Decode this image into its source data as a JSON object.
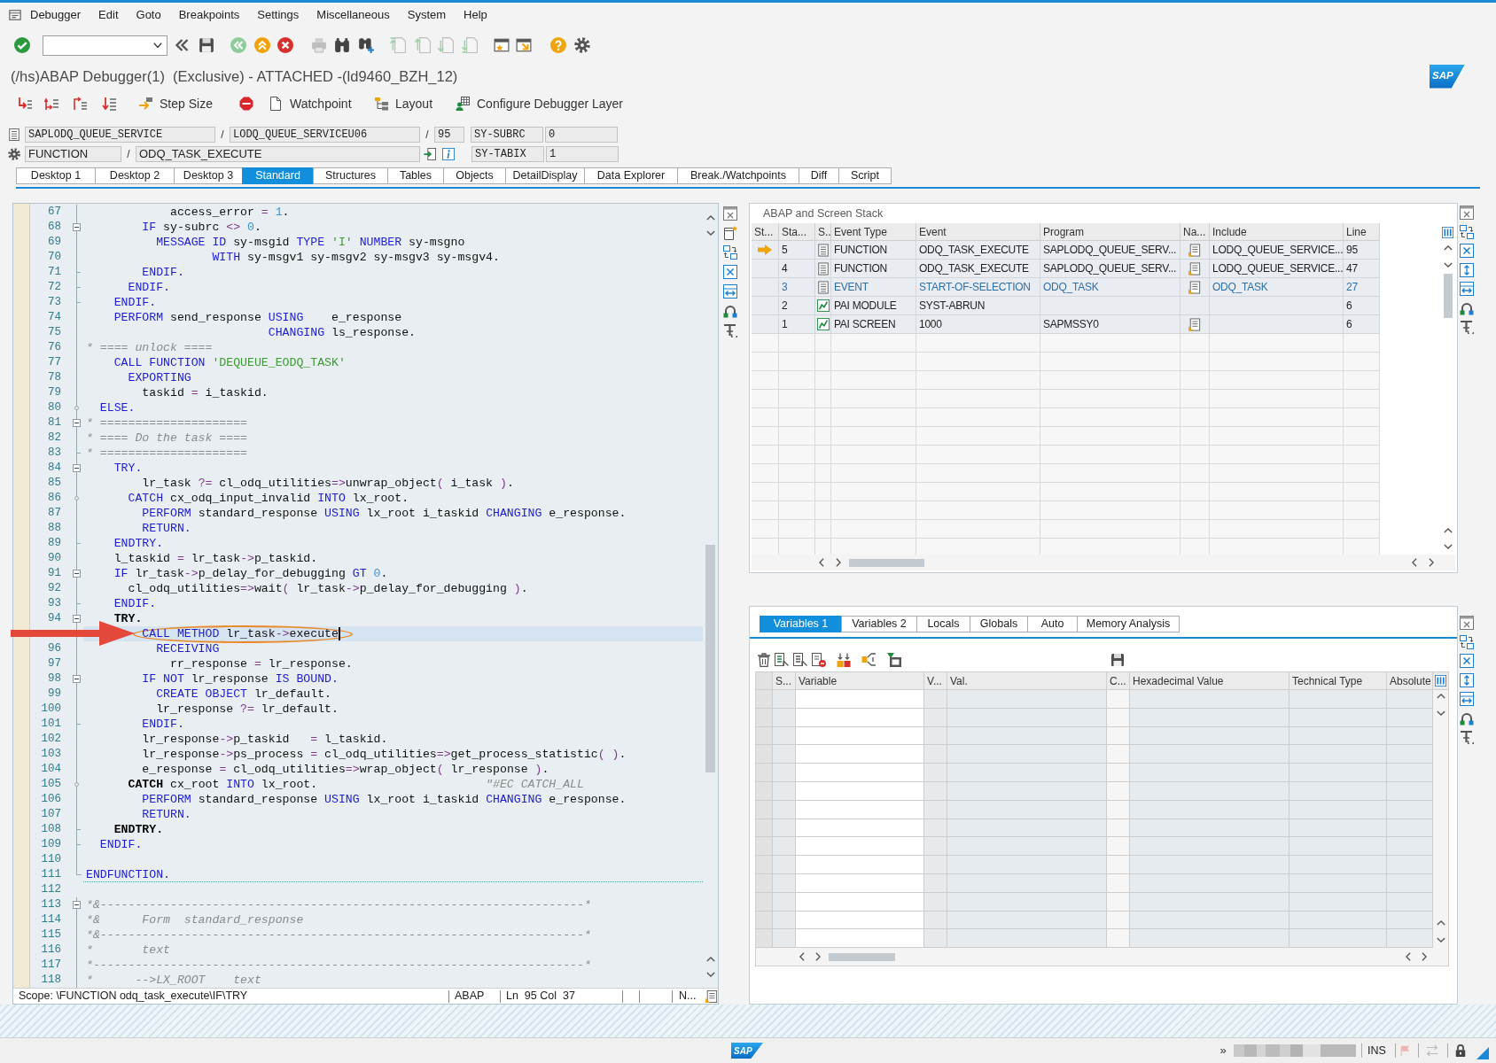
{
  "menu_bar": {
    "items": [
      "Debugger",
      "Edit",
      "Goto",
      "Breakpoints",
      "Settings",
      "Miscellaneous",
      "System",
      "Help"
    ]
  },
  "window": {
    "title": "(/hs)ABAP Debugger(1)  (Exclusive) - ATTACHED -(ld9460_BZH_12)",
    "logo": "SAP"
  },
  "app_toolbar": {
    "buttons": [
      "Step Size",
      "Watchpoint",
      "Layout",
      "Configure Debugger Layer"
    ]
  },
  "program_line": {
    "program": "SAPLODQ_QUEUE_SERVICE",
    "separator_1": "/",
    "include": "LODQ_QUEUE_SERVICEU06",
    "separator_2": "/",
    "line": "95",
    "variable": "SY-SUBRC",
    "value": "0"
  },
  "event_line": {
    "event_type": "FUNCTION",
    "separator": "/",
    "event": "ODQ_TASK_EXECUTE",
    "variable": "SY-TABIX",
    "value": "1"
  },
  "desktop_tabs": [
    {
      "label": "Desktop 1",
      "selected": false
    },
    {
      "label": "Desktop 2",
      "selected": false
    },
    {
      "label": "Desktop 3",
      "selected": false
    },
    {
      "label": "Standard",
      "selected": true
    },
    {
      "label": "Structures",
      "selected": false
    },
    {
      "label": "Tables",
      "selected": false
    },
    {
      "label": "Objects",
      "selected": false
    },
    {
      "label": "DetailDisplay",
      "selected": false
    },
    {
      "label": "Data Explorer",
      "selected": false
    },
    {
      "label": "Break./Watchpoints",
      "selected": false
    },
    {
      "label": "Diff",
      "selected": false
    },
    {
      "label": "Script",
      "selected": false
    }
  ],
  "editor": {
    "lines": [
      {
        "no": "67",
        "kind": "line",
        "current": false,
        "code": [
          {
            "kind": "tx",
            "text": "            access_error "
          },
          {
            "kind": "op",
            "text": "="
          },
          {
            "kind": "nu",
            "text": " 1"
          },
          {
            "kind": "tx",
            "text": "."
          }
        ]
      },
      {
        "no": "68",
        "kind": "open",
        "current": false,
        "code": [
          {
            "kind": "kw",
            "text": "        IF"
          },
          {
            "kind": "tx",
            "text": " sy-subrc "
          },
          {
            "kind": "op",
            "text": "<>"
          },
          {
            "kind": "nu",
            "text": " 0"
          },
          {
            "kind": "tx",
            "text": "."
          }
        ]
      },
      {
        "no": "69",
        "kind": "line",
        "current": false,
        "code": [
          {
            "kind": "kw",
            "text": "          MESSAGE ID"
          },
          {
            "kind": "tx",
            "text": " sy-msgid "
          },
          {
            "kind": "kw",
            "text": "TYPE"
          },
          {
            "kind": "st",
            "text": " 'I'"
          },
          {
            "kind": "kw",
            "text": " NUMBER"
          },
          {
            "kind": "tx",
            "text": " sy-msgno"
          }
        ]
      },
      {
        "no": "70",
        "kind": "line",
        "current": false,
        "code": [
          {
            "kind": "kw",
            "text": "                  WITH"
          },
          {
            "kind": "tx",
            "text": " sy-msgv1 sy-msgv2 sy-msgv3 sy-msgv4."
          }
        ]
      },
      {
        "no": "71",
        "kind": "end",
        "current": false,
        "code": [
          {
            "kind": "kw",
            "text": "        ENDIF."
          }
        ]
      },
      {
        "no": "72",
        "kind": "end",
        "current": false,
        "code": [
          {
            "kind": "kw",
            "text": "      ENDIF."
          }
        ]
      },
      {
        "no": "73",
        "kind": "end",
        "current": false,
        "code": [
          {
            "kind": "kw",
            "text": "    ENDIF."
          }
        ]
      },
      {
        "no": "74",
        "kind": "line",
        "current": false,
        "code": [
          {
            "kind": "kw",
            "text": "    PERFORM"
          },
          {
            "kind": "tx",
            "text": " send_response "
          },
          {
            "kind": "kw",
            "text": "USING"
          },
          {
            "kind": "tx",
            "text": "    e_response"
          }
        ]
      },
      {
        "no": "75",
        "kind": "line",
        "current": false,
        "code": [
          {
            "kind": "kw",
            "text": "                          CHANGING"
          },
          {
            "kind": "tx",
            "text": " ls_response."
          }
        ]
      },
      {
        "no": "76",
        "kind": "line",
        "current": false,
        "code": [
          {
            "kind": "cm",
            "text": "* ==== unlock ===="
          }
        ]
      },
      {
        "no": "77",
        "kind": "line",
        "current": false,
        "code": [
          {
            "kind": "kw",
            "text": "    CALL FUNCTION"
          },
          {
            "kind": "st",
            "text": " 'DEQUEUE_EODQ_TASK'"
          }
        ]
      },
      {
        "no": "78",
        "kind": "line",
        "current": false,
        "code": [
          {
            "kind": "kw",
            "text": "      EXPORTING"
          }
        ]
      },
      {
        "no": "79",
        "kind": "line",
        "current": false,
        "code": [
          {
            "kind": "tx",
            "text": "        taskid "
          },
          {
            "kind": "op",
            "text": "="
          },
          {
            "kind": "tx",
            "text": " i_taskid."
          }
        ]
      },
      {
        "no": "80",
        "kind": "branch",
        "current": false,
        "code": [
          {
            "kind": "kw",
            "text": "  ELSE."
          }
        ]
      },
      {
        "no": "81",
        "kind": "open",
        "current": false,
        "code": [
          {
            "kind": "cm",
            "text": "* ====================="
          }
        ]
      },
      {
        "no": "82",
        "kind": "line",
        "current": false,
        "code": [
          {
            "kind": "cm",
            "text": "* ==== Do the task ===="
          }
        ]
      },
      {
        "no": "83",
        "kind": "end",
        "current": false,
        "code": [
          {
            "kind": "cm",
            "text": "* ====================="
          }
        ]
      },
      {
        "no": "84",
        "kind": "open",
        "current": false,
        "code": [
          {
            "kind": "kw",
            "text": "    TRY."
          }
        ]
      },
      {
        "no": "85",
        "kind": "line",
        "current": false,
        "code": [
          {
            "kind": "tx",
            "text": "        lr_task "
          },
          {
            "kind": "op",
            "text": "?="
          },
          {
            "kind": "tx",
            "text": " cl_odq_utilities"
          },
          {
            "kind": "op",
            "text": "=>"
          },
          {
            "kind": "tx",
            "text": "unwrap_object"
          },
          {
            "kind": "op",
            "text": "("
          },
          {
            "kind": "tx",
            "text": " i_task "
          },
          {
            "kind": "op",
            "text": ")"
          },
          {
            "kind": "tx",
            "text": "."
          }
        ]
      },
      {
        "no": "86",
        "kind": "branch",
        "current": false,
        "code": [
          {
            "kind": "kw",
            "text": "      CATCH"
          },
          {
            "kind": "tx",
            "text": " cx_odq_input_invalid "
          },
          {
            "kind": "kw",
            "text": "INTO"
          },
          {
            "kind": "tx",
            "text": " lx_root."
          }
        ]
      },
      {
        "no": "87",
        "kind": "line",
        "current": false,
        "code": [
          {
            "kind": "kw",
            "text": "        PERFORM"
          },
          {
            "kind": "tx",
            "text": " standard_response "
          },
          {
            "kind": "kw",
            "text": "USING"
          },
          {
            "kind": "tx",
            "text": " lx_root i_taskid "
          },
          {
            "kind": "kw",
            "text": "CHANGING"
          },
          {
            "kind": "tx",
            "text": " e_response."
          }
        ]
      },
      {
        "no": "88",
        "kind": "line",
        "current": false,
        "code": [
          {
            "kind": "kw",
            "text": "        RETURN."
          }
        ]
      },
      {
        "no": "89",
        "kind": "end",
        "current": false,
        "code": [
          {
            "kind": "kw",
            "text": "    ENDTRY."
          }
        ]
      },
      {
        "no": "90",
        "kind": "line",
        "current": false,
        "code": [
          {
            "kind": "tx",
            "text": "    l_taskid "
          },
          {
            "kind": "op",
            "text": "="
          },
          {
            "kind": "tx",
            "text": " lr_task"
          },
          {
            "kind": "op",
            "text": "->"
          },
          {
            "kind": "tx",
            "text": "p_taskid."
          }
        ]
      },
      {
        "no": "91",
        "kind": "open",
        "current": false,
        "code": [
          {
            "kind": "kw",
            "text": "    IF"
          },
          {
            "kind": "tx",
            "text": " lr_task"
          },
          {
            "kind": "op",
            "text": "->"
          },
          {
            "kind": "tx",
            "text": "p_delay_for_debugging "
          },
          {
            "kind": "kw",
            "text": "GT"
          },
          {
            "kind": "nu",
            "text": " 0"
          },
          {
            "kind": "tx",
            "text": "."
          }
        ]
      },
      {
        "no": "92",
        "kind": "line",
        "current": false,
        "code": [
          {
            "kind": "tx",
            "text": "      cl_odq_utilities"
          },
          {
            "kind": "op",
            "text": "=>"
          },
          {
            "kind": "tx",
            "text": "wait"
          },
          {
            "kind": "op",
            "text": "("
          },
          {
            "kind": "tx",
            "text": " lr_task"
          },
          {
            "kind": "op",
            "text": "->"
          },
          {
            "kind": "tx",
            "text": "p_delay_for_debugging "
          },
          {
            "kind": "op",
            "text": ")"
          },
          {
            "kind": "tx",
            "text": "."
          }
        ]
      },
      {
        "no": "93",
        "kind": "end",
        "current": false,
        "code": [
          {
            "kind": "kw",
            "text": "    ENDIF."
          }
        ]
      },
      {
        "no": "94",
        "kind": "open",
        "current": false,
        "code": [
          {
            "kind": "hl",
            "text": "    TRY."
          }
        ]
      },
      {
        "kind": "line",
        "current": true,
        "code": [
          {
            "kind": "kw",
            "text": "        CALL METHOD"
          },
          {
            "kind": "tx",
            "text": " lr_task"
          },
          {
            "kind": "op",
            "text": "->"
          },
          {
            "kind": "tx",
            "text": "execute"
          }
        ]
      },
      {
        "no": "96",
        "kind": "line",
        "current": false,
        "code": [
          {
            "kind": "kw",
            "text": "          RECEIVING"
          }
        ]
      },
      {
        "no": "97",
        "kind": "line",
        "current": false,
        "code": [
          {
            "kind": "tx",
            "text": "            rr_response "
          },
          {
            "kind": "op",
            "text": "="
          },
          {
            "kind": "tx",
            "text": " lr_response."
          }
        ]
      },
      {
        "no": "98",
        "kind": "open",
        "current": false,
        "code": [
          {
            "kind": "kw",
            "text": "        IF NOT"
          },
          {
            "kind": "tx",
            "text": " lr_response "
          },
          {
            "kind": "kw",
            "text": "IS BOUND."
          }
        ]
      },
      {
        "no": "99",
        "kind": "line",
        "current": false,
        "code": [
          {
            "kind": "kw",
            "text": "          CREATE OBJECT"
          },
          {
            "kind": "tx",
            "text": " lr_default."
          }
        ]
      },
      {
        "no": "100",
        "kind": "line",
        "current": false,
        "code": [
          {
            "kind": "tx",
            "text": "          lr_response "
          },
          {
            "kind": "op",
            "text": "?="
          },
          {
            "kind": "tx",
            "text": " lr_default."
          }
        ]
      },
      {
        "no": "101",
        "kind": "end",
        "current": false,
        "code": [
          {
            "kind": "kw",
            "text": "        ENDIF."
          }
        ]
      },
      {
        "no": "102",
        "kind": "line",
        "current": false,
        "code": [
          {
            "kind": "tx",
            "text": "        lr_response"
          },
          {
            "kind": "op",
            "text": "->"
          },
          {
            "kind": "tx",
            "text": "p_taskid   "
          },
          {
            "kind": "op",
            "text": "="
          },
          {
            "kind": "tx",
            "text": " l_taskid."
          }
        ]
      },
      {
        "no": "103",
        "kind": "line",
        "current": false,
        "code": [
          {
            "kind": "tx",
            "text": "        lr_response"
          },
          {
            "kind": "op",
            "text": "->"
          },
          {
            "kind": "tx",
            "text": "ps_process "
          },
          {
            "kind": "op",
            "text": "="
          },
          {
            "kind": "tx",
            "text": " cl_odq_utilities"
          },
          {
            "kind": "op",
            "text": "=>"
          },
          {
            "kind": "tx",
            "text": "get_process_statistic"
          },
          {
            "kind": "op",
            "text": "( )"
          },
          {
            "kind": "tx",
            "text": "."
          }
        ]
      },
      {
        "no": "104",
        "kind": "line",
        "current": false,
        "code": [
          {
            "kind": "tx",
            "text": "        e_response "
          },
          {
            "kind": "op",
            "text": "="
          },
          {
            "kind": "tx",
            "text": " cl_odq_utilities"
          },
          {
            "kind": "op",
            "text": "=>"
          },
          {
            "kind": "tx",
            "text": "wrap_object"
          },
          {
            "kind": "op",
            "text": "("
          },
          {
            "kind": "tx",
            "text": " lr_response "
          },
          {
            "kind": "op",
            "text": ")"
          },
          {
            "kind": "tx",
            "text": "."
          }
        ]
      },
      {
        "no": "105",
        "kind": "branch",
        "current": false,
        "code": [
          {
            "kind": "hl",
            "text": "      CATCH"
          },
          {
            "kind": "tx",
            "text": " cx_root "
          },
          {
            "kind": "kw",
            "text": "INTO"
          },
          {
            "kind": "tx",
            "text": " lx_root."
          },
          {
            "kind": "cm",
            "text": "                        \"#EC CATCH_ALL"
          }
        ]
      },
      {
        "no": "106",
        "kind": "line",
        "current": false,
        "code": [
          {
            "kind": "kw",
            "text": "        PERFORM"
          },
          {
            "kind": "tx",
            "text": " standard_response "
          },
          {
            "kind": "kw",
            "text": "USING"
          },
          {
            "kind": "tx",
            "text": " lx_root i_taskid "
          },
          {
            "kind": "kw",
            "text": "CHANGING"
          },
          {
            "kind": "tx",
            "text": " e_response."
          }
        ]
      },
      {
        "no": "107",
        "kind": "line",
        "current": false,
        "code": [
          {
            "kind": "kw",
            "text": "        RETURN."
          }
        ]
      },
      {
        "no": "108",
        "kind": "end",
        "current": false,
        "code": [
          {
            "kind": "hl",
            "text": "    ENDTRY."
          }
        ]
      },
      {
        "no": "109",
        "kind": "end",
        "current": false,
        "code": [
          {
            "kind": "kw",
            "text": "  ENDIF."
          }
        ]
      },
      {
        "no": "110",
        "kind": "line",
        "current": false
      },
      {
        "no": "111",
        "kind": "last",
        "current": false,
        "code": [
          {
            "kind": "kw",
            "text": "ENDFUNCTION."
          }
        ]
      },
      {
        "no": "112",
        "kind": "none",
        "current": false
      },
      {
        "no": "113",
        "kind": "open",
        "current": false,
        "code": [
          {
            "kind": "cm",
            "text": "*&---------------------------------------------------------------------*"
          }
        ]
      },
      {
        "no": "114",
        "kind": "line",
        "current": false,
        "code": [
          {
            "kind": "cm",
            "text": "*&      Form  standard_response"
          }
        ]
      },
      {
        "no": "115",
        "kind": "line",
        "current": false,
        "code": [
          {
            "kind": "cm",
            "text": "*&---------------------------------------------------------------------*"
          }
        ]
      },
      {
        "no": "116",
        "kind": "line",
        "current": false,
        "code": [
          {
            "kind": "cm",
            "text": "*       text"
          }
        ]
      },
      {
        "no": "117",
        "kind": "line",
        "current": false,
        "code": [
          {
            "kind": "cm",
            "text": "*----------------------------------------------------------------------*"
          }
        ]
      },
      {
        "no": "118",
        "kind": "line",
        "current": false,
        "code": [
          {
            "kind": "cm",
            "text": "*      -->LX_ROOT    text"
          }
        ]
      }
    ]
  },
  "editor_status": {
    "scope": "Scope: \\FUNCTION odq_task_execute\\IF\\TRY",
    "language": "ABAP",
    "position": "Ln  95 Col  37",
    "field_4": "N..."
  },
  "stack_panel": {
    "title": "ABAP and Screen Stack",
    "columns": [
      "St...",
      "Sta...",
      "S..",
      "Event Type",
      "Event",
      "Program",
      "Na...",
      "Include",
      "Line"
    ],
    "rows": [
      {
        "current": true,
        "column_2": "5",
        "kind": "program",
        "event_type": "FUNCTION",
        "event": "ODQ_TASK_EXECUTE",
        "program": "SAPLODQ_QUEUE_SERV...",
        "column_7_icon": true,
        "include": "LODQ_QUEUE_SERVICE...",
        "line": "95",
        "color": "#222222"
      },
      {
        "current": false,
        "column_2": "4",
        "kind": "program",
        "event_type": "FUNCTION",
        "event": "ODQ_TASK_EXECUTE",
        "program": "SAPLODQ_QUEUE_SERV...",
        "column_7_icon": true,
        "include": "LODQ_QUEUE_SERVICE...",
        "line": "47",
        "color": "#222222"
      },
      {
        "current": false,
        "column_2": "3",
        "kind": "program",
        "event_type": "EVENT",
        "event": "START-OF-SELECTION",
        "program": "ODQ_TASK",
        "column_7_icon": true,
        "include": "ODQ_TASK",
        "line": "27",
        "color": "#2e6ea8"
      },
      {
        "current": false,
        "column_2": "2",
        "kind": "screen",
        "event_type": "PAI MODULE",
        "event": "SYST-ABRUN",
        "column_7_icon": false,
        "line": "6",
        "color": "#222222"
      },
      {
        "current": false,
        "column_2": "1",
        "kind": "screen",
        "event_type": "PAI SCREEN",
        "event": "1000",
        "program": "SAPMSSY0",
        "column_7_icon": true,
        "line": "6",
        "color": "#222222"
      }
    ]
  },
  "variables_panel": {
    "tabs": [
      {
        "label": "Variables 1",
        "selected": true
      },
      {
        "label": "Variables 2",
        "selected": false
      },
      {
        "label": "Locals",
        "selected": false
      },
      {
        "label": "Globals",
        "selected": false
      },
      {
        "label": "Auto",
        "selected": false
      },
      {
        "label": "Memory Analysis",
        "selected": false
      }
    ],
    "columns": [
      "S...",
      "Variable",
      "V...",
      "Val.",
      "C...",
      "Hexadecimal Value",
      "Technical Type",
      "Absolute"
    ]
  },
  "status_bar": {
    "logo": "SAP",
    "expand": "»",
    "mode": "INS"
  }
}
